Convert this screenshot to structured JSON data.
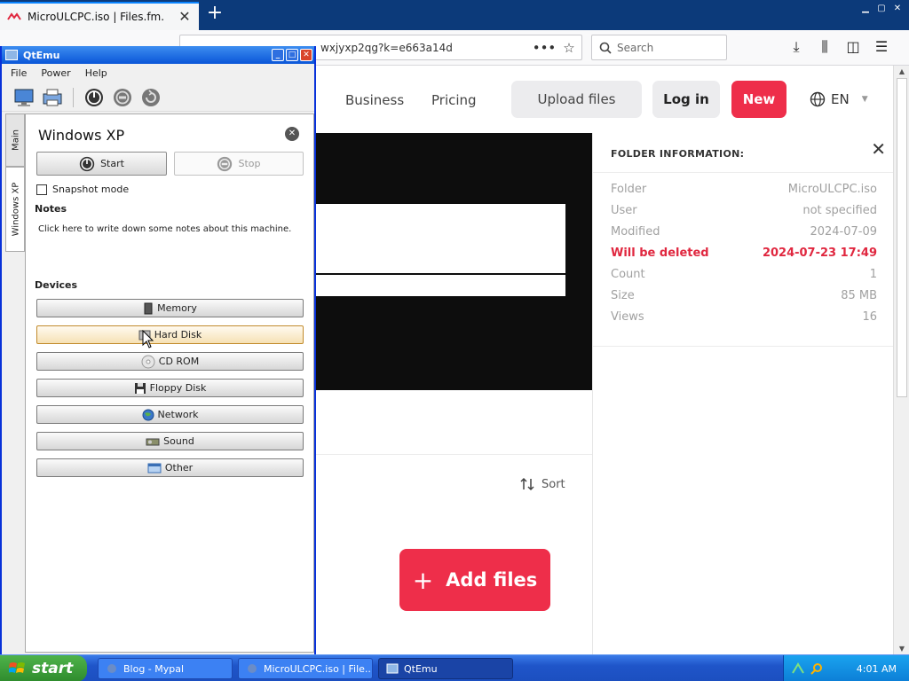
{
  "browser": {
    "tab_title": "MicroULCPC.iso | Files.fm.",
    "url": "wxjyxp2qg?k=e663a14d",
    "search_placeholder": "Search"
  },
  "site": {
    "nav": [
      "Business",
      "Pricing"
    ],
    "upload_label": "Upload files",
    "login_label": "Log in",
    "new_label": "New",
    "lang": "EN",
    "sort_label": "Sort",
    "add_files_label": "Add files",
    "accent": "#ee2e4a"
  },
  "folder_info": {
    "title": "FOLDER INFORMATION:",
    "rows": [
      {
        "key": "Folder",
        "value": "MicroULCPC.iso"
      },
      {
        "key": "User",
        "value": "not specified"
      },
      {
        "key": "Modified",
        "value": "2024-07-09"
      },
      {
        "key": "Will be deleted",
        "value": "2024-07-23 17:49",
        "highlight": true
      },
      {
        "key": "Count",
        "value": "1"
      },
      {
        "key": "Size",
        "value": "85 MB"
      },
      {
        "key": "Views",
        "value": "16"
      }
    ]
  },
  "qtemu": {
    "title": "QtEmu",
    "menu": [
      "File",
      "Power",
      "Help"
    ],
    "side_tabs": [
      "Main",
      "Windows XP"
    ],
    "vm_name": "Windows XP",
    "start_label": "Start",
    "stop_label": "Stop",
    "snapshot_label": "Snapshot mode",
    "notes_label": "Notes",
    "notes_text": "Click here to write down some notes about this machine.",
    "devices_label": "Devices",
    "devices": [
      "Memory",
      "Hard Disk",
      "CD ROM",
      "Floppy Disk",
      "Network",
      "Sound",
      "Other"
    ]
  },
  "taskbar": {
    "start_label": "start",
    "tasks": [
      "Blog - Mypal",
      "MicroULCPC.iso | File...",
      "QtEmu"
    ],
    "clock": "4:01 AM"
  }
}
